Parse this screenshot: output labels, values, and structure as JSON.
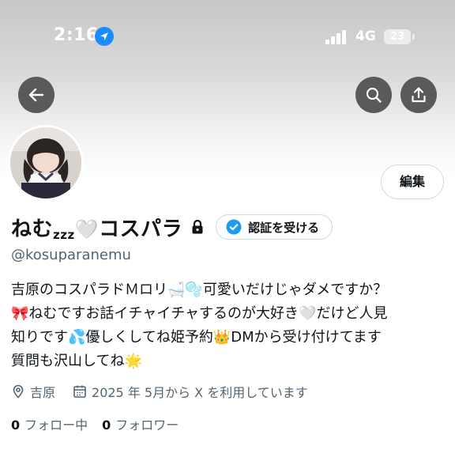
{
  "status_bar": {
    "time": "2:16",
    "network": "4G",
    "battery": "23"
  },
  "toolbar": {
    "back_icon": "arrow-left-icon",
    "search_icon": "search-icon",
    "share_icon": "share-icon"
  },
  "profile": {
    "edit_label": "編集",
    "display_name": "ねむ",
    "zzz": "zzz",
    "display_name_rest": "コスパラ",
    "verify_label": "認証を受ける",
    "handle": "@kosuparanemu",
    "bio_lines": [
      "吉原のコスパラドＭロリ🛁🫧可愛いだけじゃダメですか？",
      "🎀ねむですお話イチャイチャするのが大好き🤍だけど人見",
      "知りです💦優しくしてね姫予約👑DMから受け付けてます",
      "質問も沢山してね🌟"
    ],
    "location": "吉原",
    "joined": "2025 年 5月から X を利用しています",
    "following_count": "0",
    "following_label": "フォロー中",
    "followers_count": "0",
    "followers_label": "フォロワー"
  },
  "colors": {
    "accent": "#1d9bf0",
    "text": "#0f1419",
    "secondary_text": "#536471",
    "border": "#cfd9de",
    "overlay_button": "#5a5a5a"
  }
}
